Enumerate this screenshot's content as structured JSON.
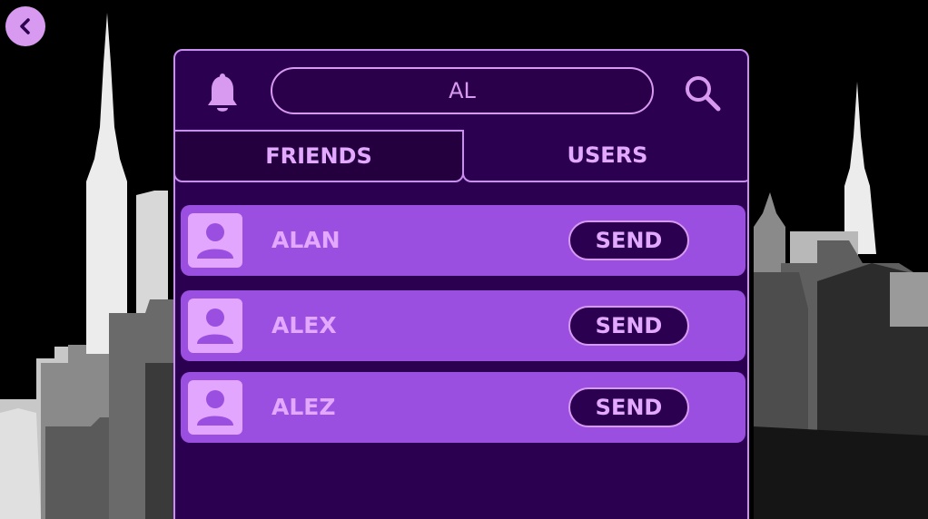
{
  "header": {
    "back_icon": "chevron-left-icon",
    "bell_icon": "bell-icon",
    "search_icon": "search-icon"
  },
  "search": {
    "value": "AL"
  },
  "tabs": [
    {
      "label": "FRIENDS",
      "selected": true
    },
    {
      "label": "USERS",
      "selected": false
    }
  ],
  "results": [
    {
      "name": "ALAN",
      "action": "SEND"
    },
    {
      "name": "ALEX",
      "action": "SEND"
    },
    {
      "name": "ALEZ",
      "action": "SEND"
    }
  ],
  "colors": {
    "panel_bg": "#2c0050",
    "accent": "#d79af0",
    "row_bg": "#9b4fe1",
    "text": "#e3a8ff"
  }
}
